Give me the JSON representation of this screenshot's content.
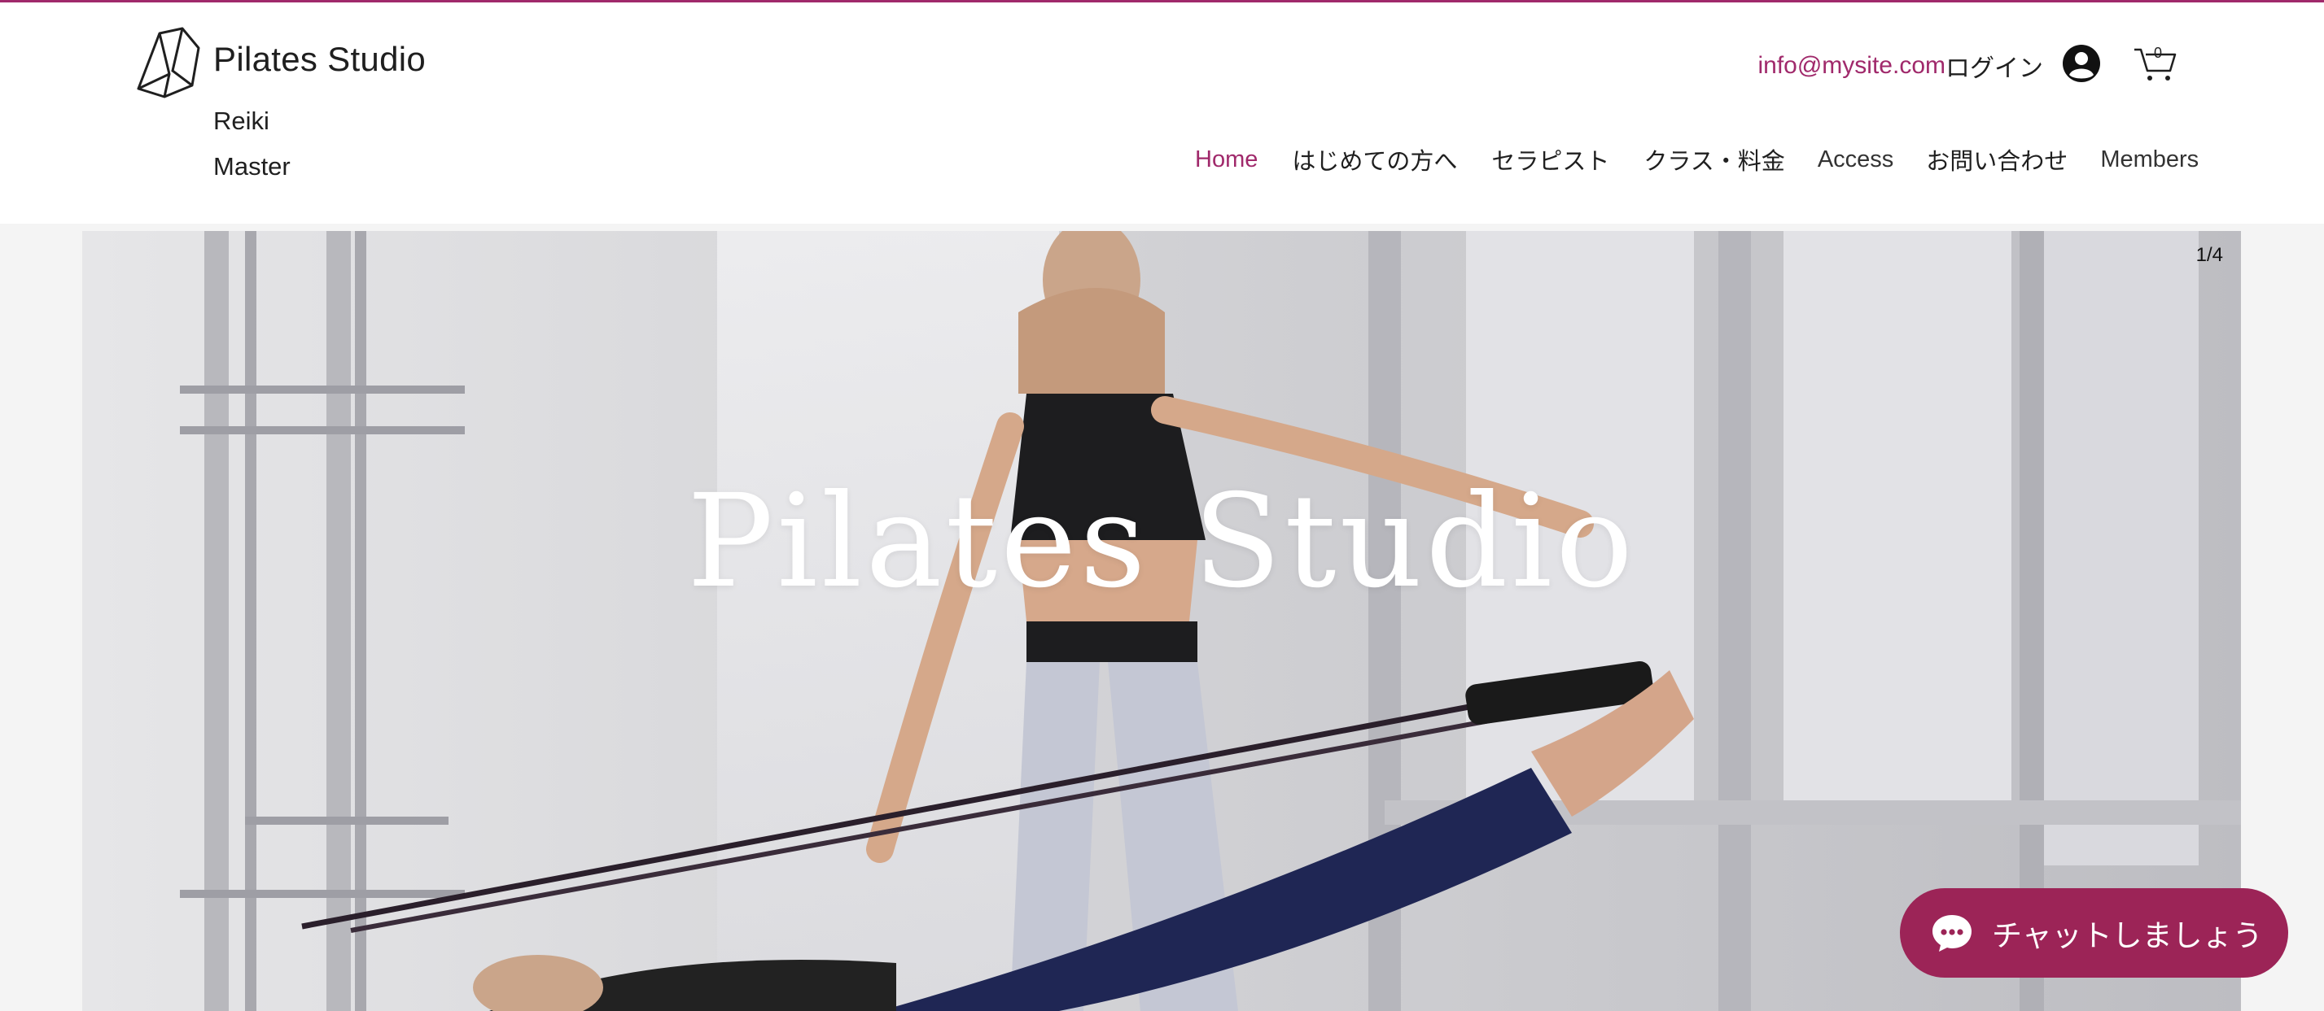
{
  "header": {
    "brand_title": "Pilates Studio",
    "tagline_line1": "Reiki",
    "tagline_line2": "Master",
    "email": "info@mysite.com",
    "login_label": "ログイン",
    "cart_count": "0"
  },
  "nav": {
    "items": [
      {
        "label": "Home",
        "active": true
      },
      {
        "label": "はじめての方へ"
      },
      {
        "label": "セラピスト"
      },
      {
        "label": "クラス・料金"
      },
      {
        "label": "Access"
      },
      {
        "label": "お問い合わせ"
      },
      {
        "label": "Members"
      }
    ]
  },
  "hero": {
    "title": "Pilates Studio",
    "slide_counter": "1/4"
  },
  "chat": {
    "label": "チャットしましょう"
  },
  "colors": {
    "accent": "#a0296b",
    "chat_bg": "#9c2457",
    "text": "#1f1f1f"
  },
  "icons": [
    "logo-icon",
    "avatar-icon",
    "cart-icon",
    "chat-bubble-icon"
  ]
}
